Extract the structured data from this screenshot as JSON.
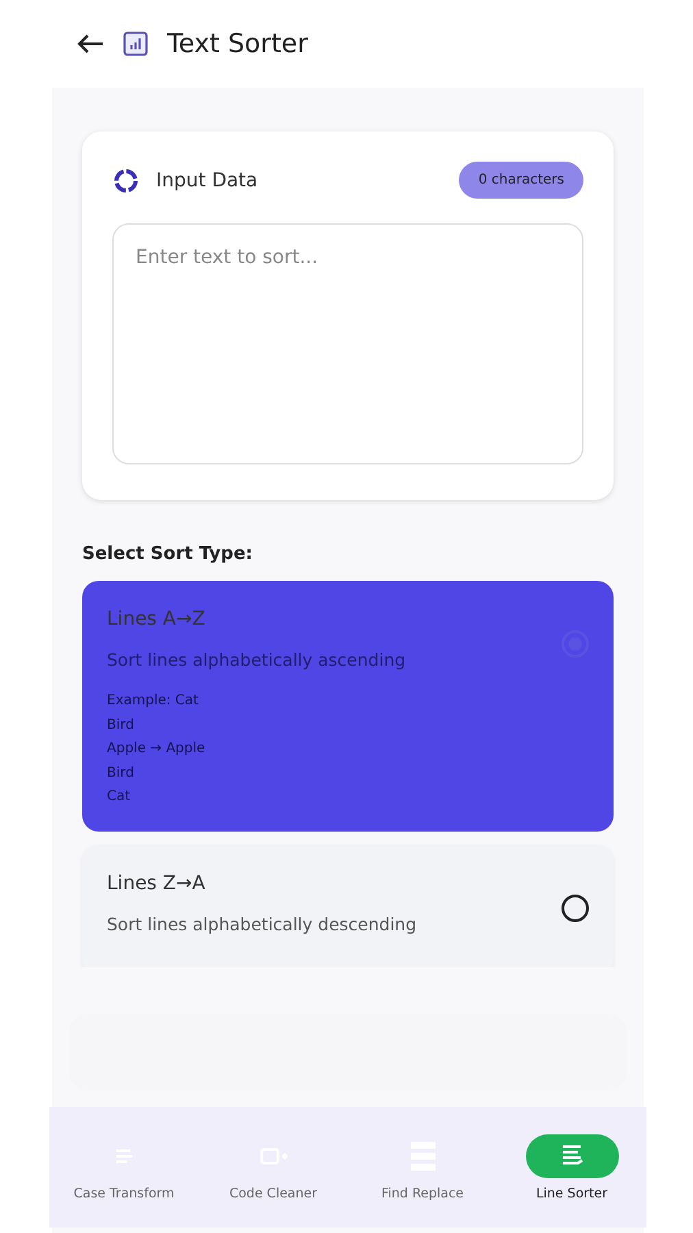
{
  "header": {
    "title": "Text Sorter"
  },
  "input_card": {
    "title": "Input Data",
    "count": "0 characters",
    "placeholder": "Enter text to sort..."
  },
  "sort_section": {
    "heading": "Select Sort Type:",
    "options": [
      {
        "title": "Lines A→Z",
        "description": "Sort lines alphabetically ascending",
        "example": [
          "Example: Cat",
          "Bird",
          "Apple → Apple",
          "Bird",
          "Cat"
        ],
        "selected": true
      },
      {
        "title": "Lines Z→A",
        "description": "Sort lines alphabetically descending",
        "selected": false
      }
    ]
  },
  "bottom_nav": [
    {
      "label": "Case Transform",
      "kind": "case",
      "selected": false
    },
    {
      "label": "Code Cleaner",
      "kind": "code",
      "selected": false
    },
    {
      "label": "Find Replace",
      "kind": "find",
      "selected": false
    },
    {
      "label": "Line Sorter",
      "kind": "sort",
      "selected": true
    }
  ]
}
